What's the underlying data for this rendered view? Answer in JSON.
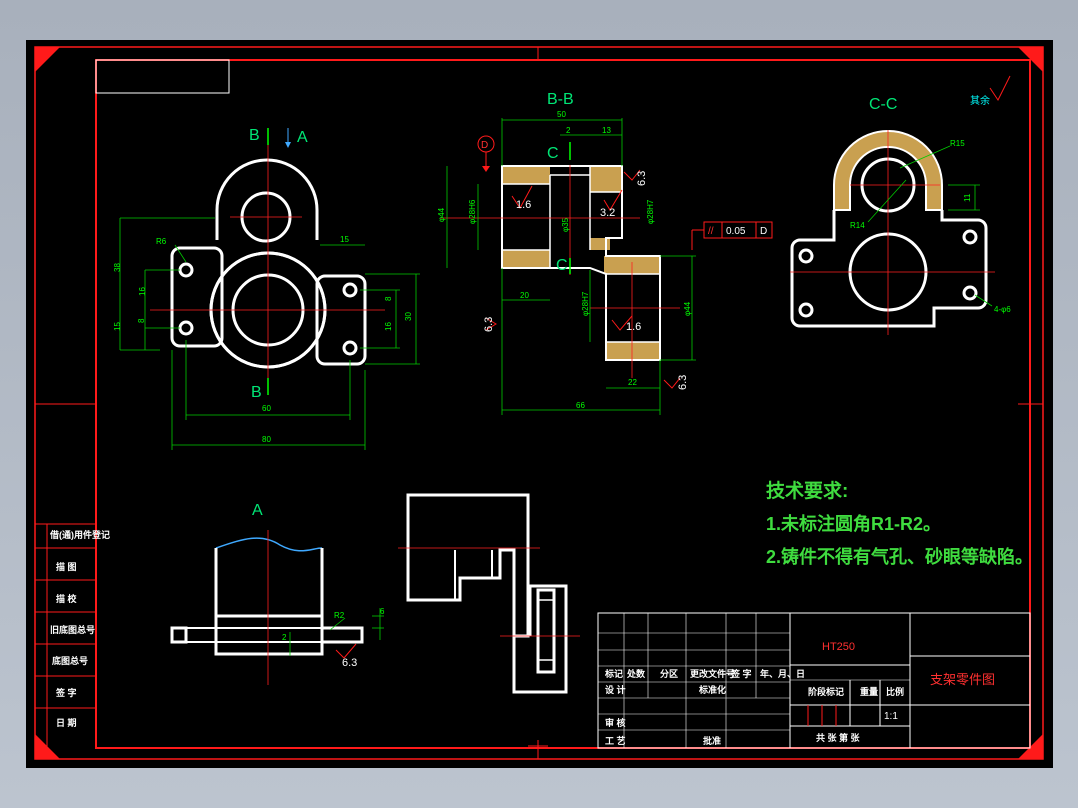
{
  "views": {
    "section_bb": "B-B",
    "section_cc": "C-C",
    "view_b_top": "B",
    "view_a_arrow": "A",
    "view_b_bottom": "B",
    "view_c_top": "C",
    "view_c_bottom": "C",
    "detail_a": "A"
  },
  "datum": "D",
  "tolerance": {
    "symbol": "//",
    "value": "0.05",
    "datum": "D"
  },
  "roughness": {
    "r1": "1.6",
    "r2": "3.2",
    "r3": "6.3",
    "r4": "6.3",
    "r5": "1.6",
    "r6": "6.3",
    "r7": "6.3",
    "remaining": "其余"
  },
  "dims_front": {
    "d38": "38",
    "d16a": "16",
    "d15": "15",
    "d8a": "8",
    "r6": "R6",
    "d15b": "15",
    "d8b": "8",
    "d16b": "16",
    "d30": "30",
    "d60": "60",
    "d80": "80"
  },
  "dims_section": {
    "d50": "50",
    "d2": "2",
    "d13": "13",
    "d44a": "φ44",
    "d28h6": "φ28H6",
    "d35": "φ35",
    "d28h7a": "φ28H7",
    "d20": "20",
    "d28h7b": "φ28H7",
    "d44b": "φ44",
    "d22": "22",
    "d66": "66"
  },
  "dims_cc": {
    "r15": "R15",
    "r14": "R14",
    "d11": "11",
    "holes": "4-φ6"
  },
  "dims_detail": {
    "r2": "R2",
    "d6": "6",
    "d2": "2"
  },
  "tech": {
    "title": "技术要求:",
    "line1": "1.未标注圆角R1-R2。",
    "line2": "2.铸件不得有气孔、砂眼等缺陷。"
  },
  "side_table": [
    "借(通)用件登记",
    "描 图",
    "描 校",
    "旧底图总号",
    "底图总号",
    "签 字",
    "日 期"
  ],
  "title_block": {
    "material": "HT250",
    "part_name": "支架零件图",
    "headers": [
      "标记",
      "处数",
      "分区",
      "更改文件号",
      "签 字",
      "年、月、日"
    ],
    "design": "设 计",
    "standard": "标准化",
    "stage": "阶段标记",
    "weight": "重量",
    "scale_label": "比例",
    "scale": "1:1",
    "review": "审 核",
    "process": "工 艺",
    "approve": "批准",
    "sheets": "共    张 第    张"
  }
}
